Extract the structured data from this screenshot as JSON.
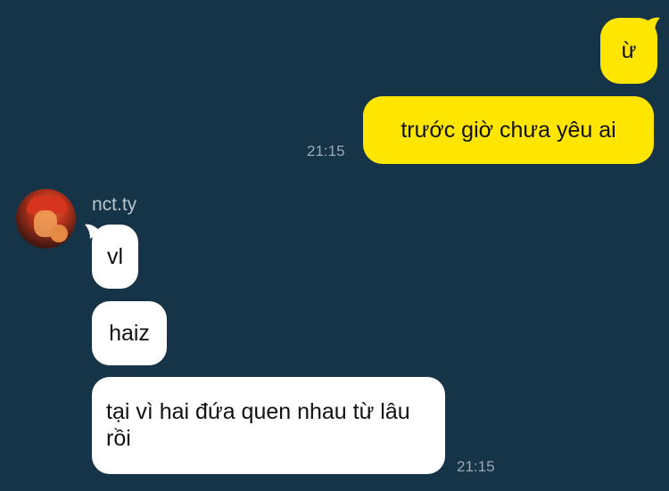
{
  "colors": {
    "background": "#163447",
    "outgoing_bubble": "#ffe600",
    "incoming_bubble": "#ffffff",
    "timestamp": "#9aa9b5",
    "sender_name": "#b7c3cc"
  },
  "messages": {
    "outgoing": [
      {
        "text": "ừ"
      },
      {
        "text": "trước giờ chưa yêu ai",
        "time": "21:15"
      }
    ],
    "incoming_sender": "nct.ty",
    "incoming_avatar_icon": "user-avatar-photo",
    "incoming": [
      {
        "text": "vl"
      },
      {
        "text": "haiz"
      },
      {
        "text": "tại vì hai đứa quen nhau từ lâu rồi",
        "time": "21:15"
      }
    ]
  }
}
